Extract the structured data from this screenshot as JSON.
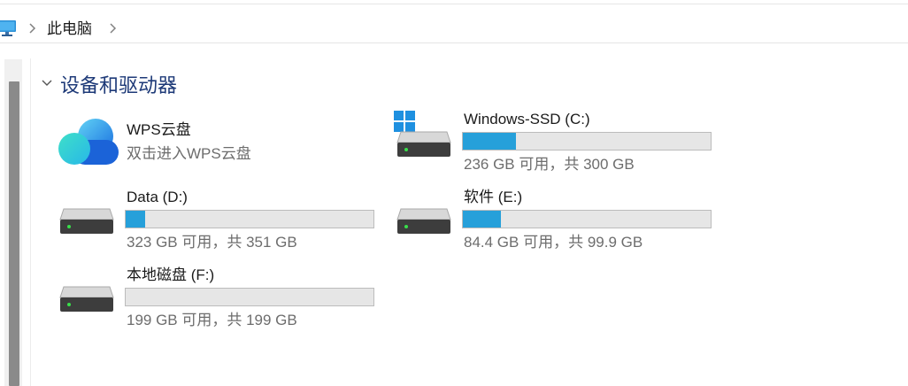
{
  "breadcrumb": {
    "location": "此电脑"
  },
  "section": {
    "title": "设备和驱动器"
  },
  "cloud": {
    "name": "WPS云盘",
    "subtitle": "双击进入WPS云盘"
  },
  "drives": [
    {
      "id": "c",
      "name": "Windows-SSD (C:)",
      "free_text": "236 GB 可用，共 300 GB",
      "used_fraction": 0.213
    },
    {
      "id": "d",
      "name": "Data (D:)",
      "free_text": "323 GB 可用，共 351 GB",
      "used_fraction": 0.08
    },
    {
      "id": "e",
      "name": "软件 (E:)",
      "free_text": "84.4 GB 可用，共 99.9 GB",
      "used_fraction": 0.155
    },
    {
      "id": "f",
      "name": "本地磁盘 (F:)",
      "free_text": "199 GB 可用，共 199 GB",
      "used_fraction": 0.0
    }
  ],
  "colors": {
    "accent": "#26a0da",
    "section_title": "#1e3a78",
    "bar_bg": "#e6e6e6"
  }
}
